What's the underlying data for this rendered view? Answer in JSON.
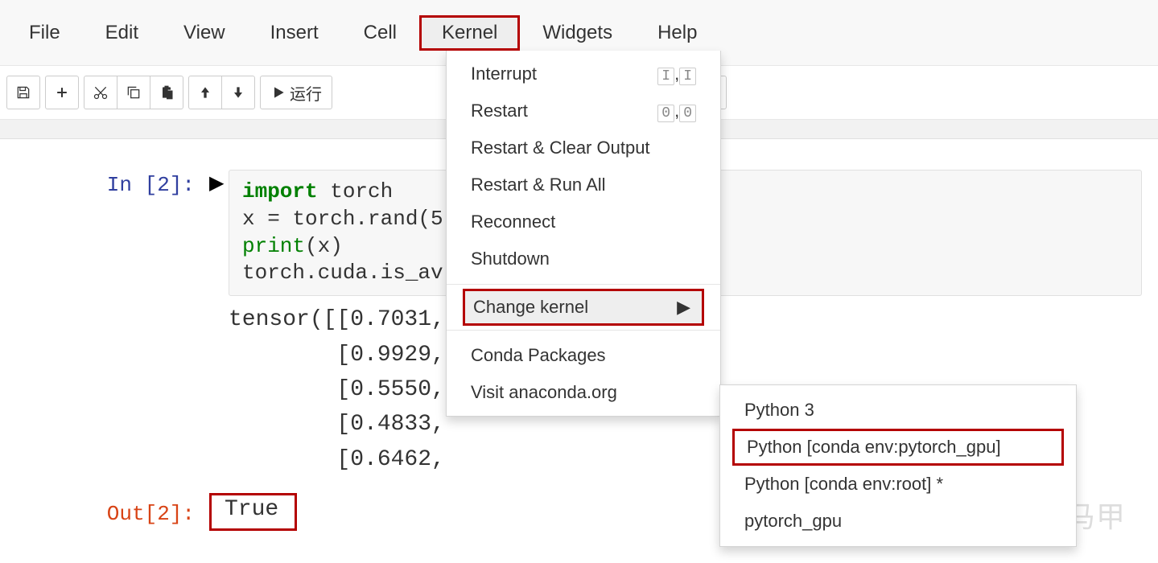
{
  "menubar": {
    "items": [
      "File",
      "Edit",
      "View",
      "Insert",
      "Cell",
      "Kernel",
      "Widgets",
      "Help"
    ],
    "active": "Kernel"
  },
  "toolbar": {
    "run_label": "运行"
  },
  "kernel_menu": {
    "interrupt": "Interrupt",
    "interrupt_shortcut": [
      "I",
      "I"
    ],
    "restart": "Restart",
    "restart_shortcut": [
      "0",
      "0"
    ],
    "restart_clear": "Restart & Clear Output",
    "restart_run_all": "Restart & Run All",
    "reconnect": "Reconnect",
    "shutdown": "Shutdown",
    "change_kernel": "Change kernel",
    "conda_packages": "Conda Packages",
    "visit_anaconda": "Visit anaconda.org"
  },
  "kernel_submenu": {
    "items": [
      "Python 3",
      "Python [conda env:pytorch_gpu]",
      "Python [conda env:root] *",
      "pytorch_gpu"
    ],
    "highlighted": "Python [conda env:pytorch_gpu]"
  },
  "cell": {
    "in_prompt": "In [2]:",
    "out_prompt": "Out[2]:",
    "code_line1_kw": "import",
    "code_line1_rest": " torch",
    "code_line2_pre": "x = torch.rand(5",
    "code_line2_rest": "",
    "code_line3_fn": "print",
    "code_line3_rest": "(x)",
    "code_line4": "torch.cuda.is_av",
    "output_tensor": "tensor([[0.7031,\n        [0.9929,\n        [0.5550,\n        [0.4833,\n        [0.6462,",
    "output_true": "True"
  },
  "watermark": "知乎 @虹膜小马甲"
}
